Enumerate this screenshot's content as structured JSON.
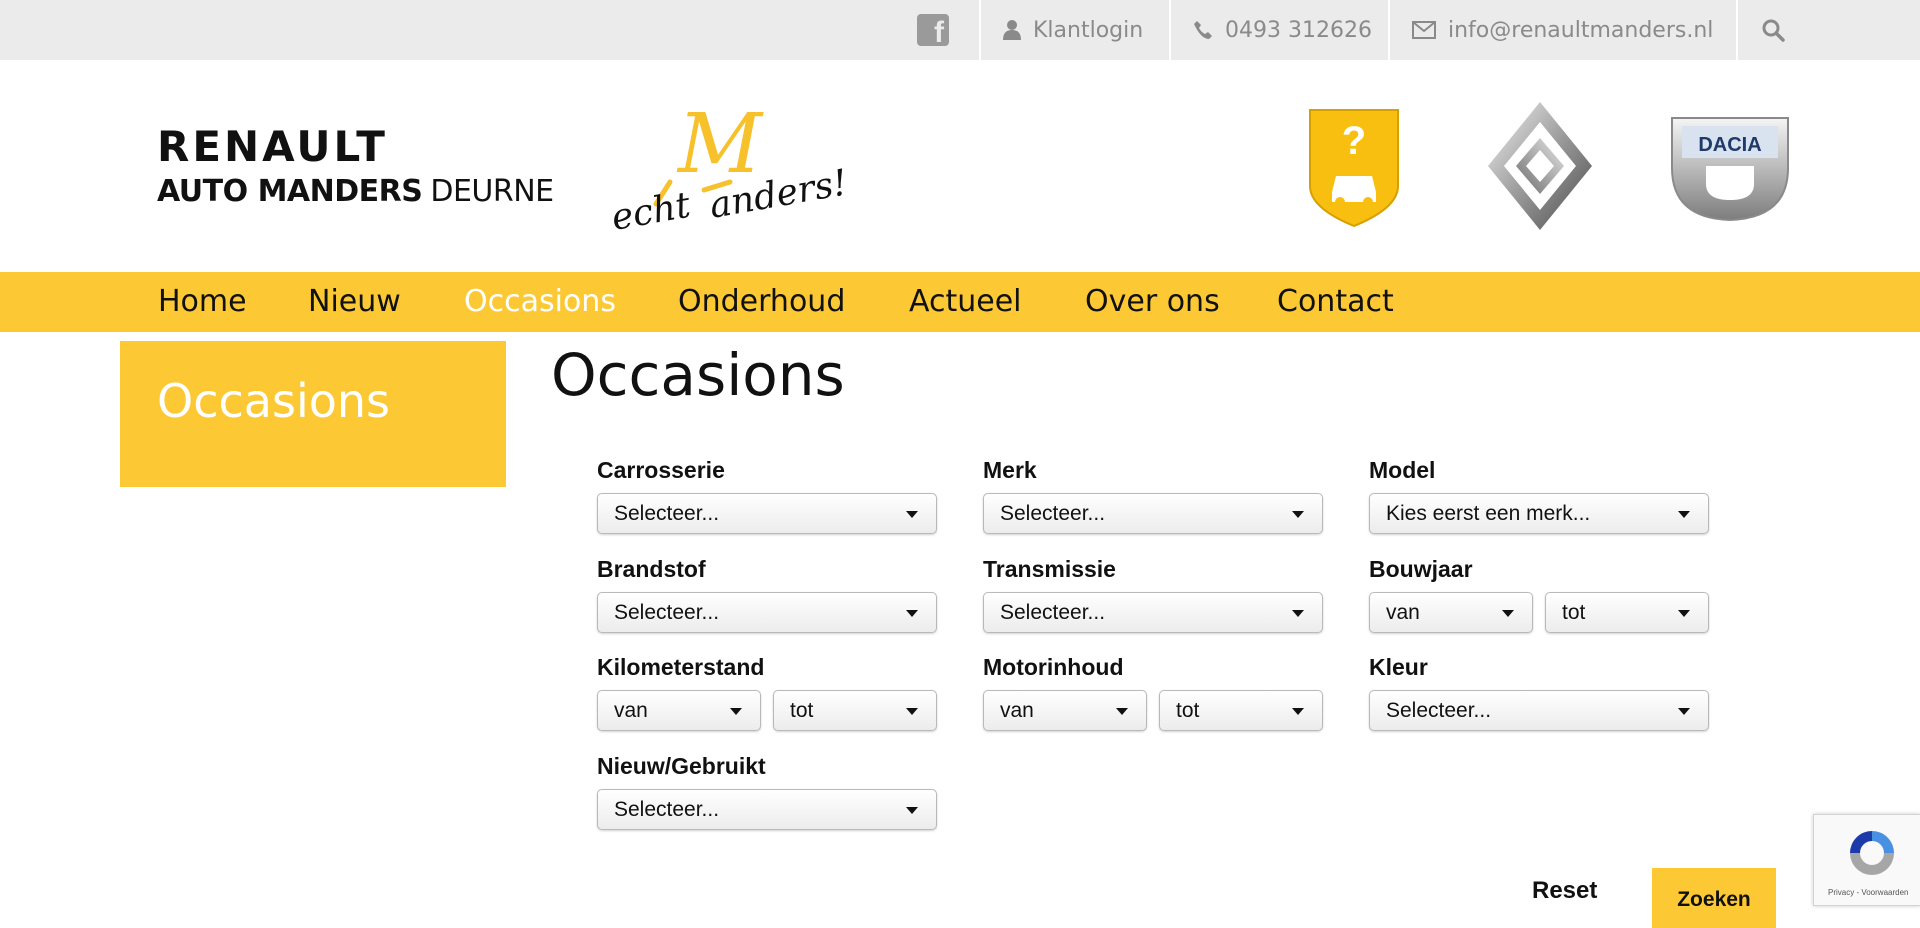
{
  "topbar": {
    "facebook_icon": "facebook-icon",
    "login_label": "Klantlogin",
    "phone": "0493 312626",
    "email": "info@renaultmanders.nl",
    "search_icon": "search-icon"
  },
  "header": {
    "brand_line1": "RENAULT",
    "brand_line2_bold": "AUTO MANDERS",
    "brand_line2_light": "DEURNE",
    "slogan_part1": "echt",
    "slogan_part2": "anders!",
    "slogan_mark": "M",
    "dacia_logo_text": "DACIA"
  },
  "nav": {
    "items": [
      {
        "label": "Home",
        "active": false
      },
      {
        "label": "Nieuw",
        "active": false
      },
      {
        "label": "Occasions",
        "active": true
      },
      {
        "label": "Onderhoud",
        "active": false
      },
      {
        "label": "Actueel",
        "active": false
      },
      {
        "label": "Over ons",
        "active": false
      },
      {
        "label": "Contact",
        "active": false
      }
    ]
  },
  "sidebar": {
    "title": "Occasions"
  },
  "page": {
    "title": "Occasions"
  },
  "filters": {
    "carrosserie": {
      "label": "Carrosserie",
      "value": "Selecteer..."
    },
    "merk": {
      "label": "Merk",
      "value": "Selecteer..."
    },
    "model": {
      "label": "Model",
      "value": "Kies eerst een merk..."
    },
    "brandstof": {
      "label": "Brandstof",
      "value": "Selecteer..."
    },
    "transmissie": {
      "label": "Transmissie",
      "value": "Selecteer..."
    },
    "bouwjaar": {
      "label": "Bouwjaar",
      "from": "van",
      "to": "tot"
    },
    "kilometerstand": {
      "label": "Kilometerstand",
      "from": "van",
      "to": "tot"
    },
    "motorinhoud": {
      "label": "Motorinhoud",
      "from": "van",
      "to": "tot"
    },
    "kleur": {
      "label": "Kleur",
      "value": "Selecteer..."
    },
    "nieuw_gebruikt": {
      "label": "Nieuw/Gebruikt",
      "value": "Selecteer..."
    }
  },
  "actions": {
    "reset_label": "Reset",
    "search_label": "Zoeken"
  },
  "recaptcha": {
    "footer_text": "Privacy - Voorwaarden"
  },
  "colors": {
    "accent_yellow": "#fcc934",
    "topbar_bg": "#ebebeb",
    "topbar_text": "#8a8a8a"
  }
}
